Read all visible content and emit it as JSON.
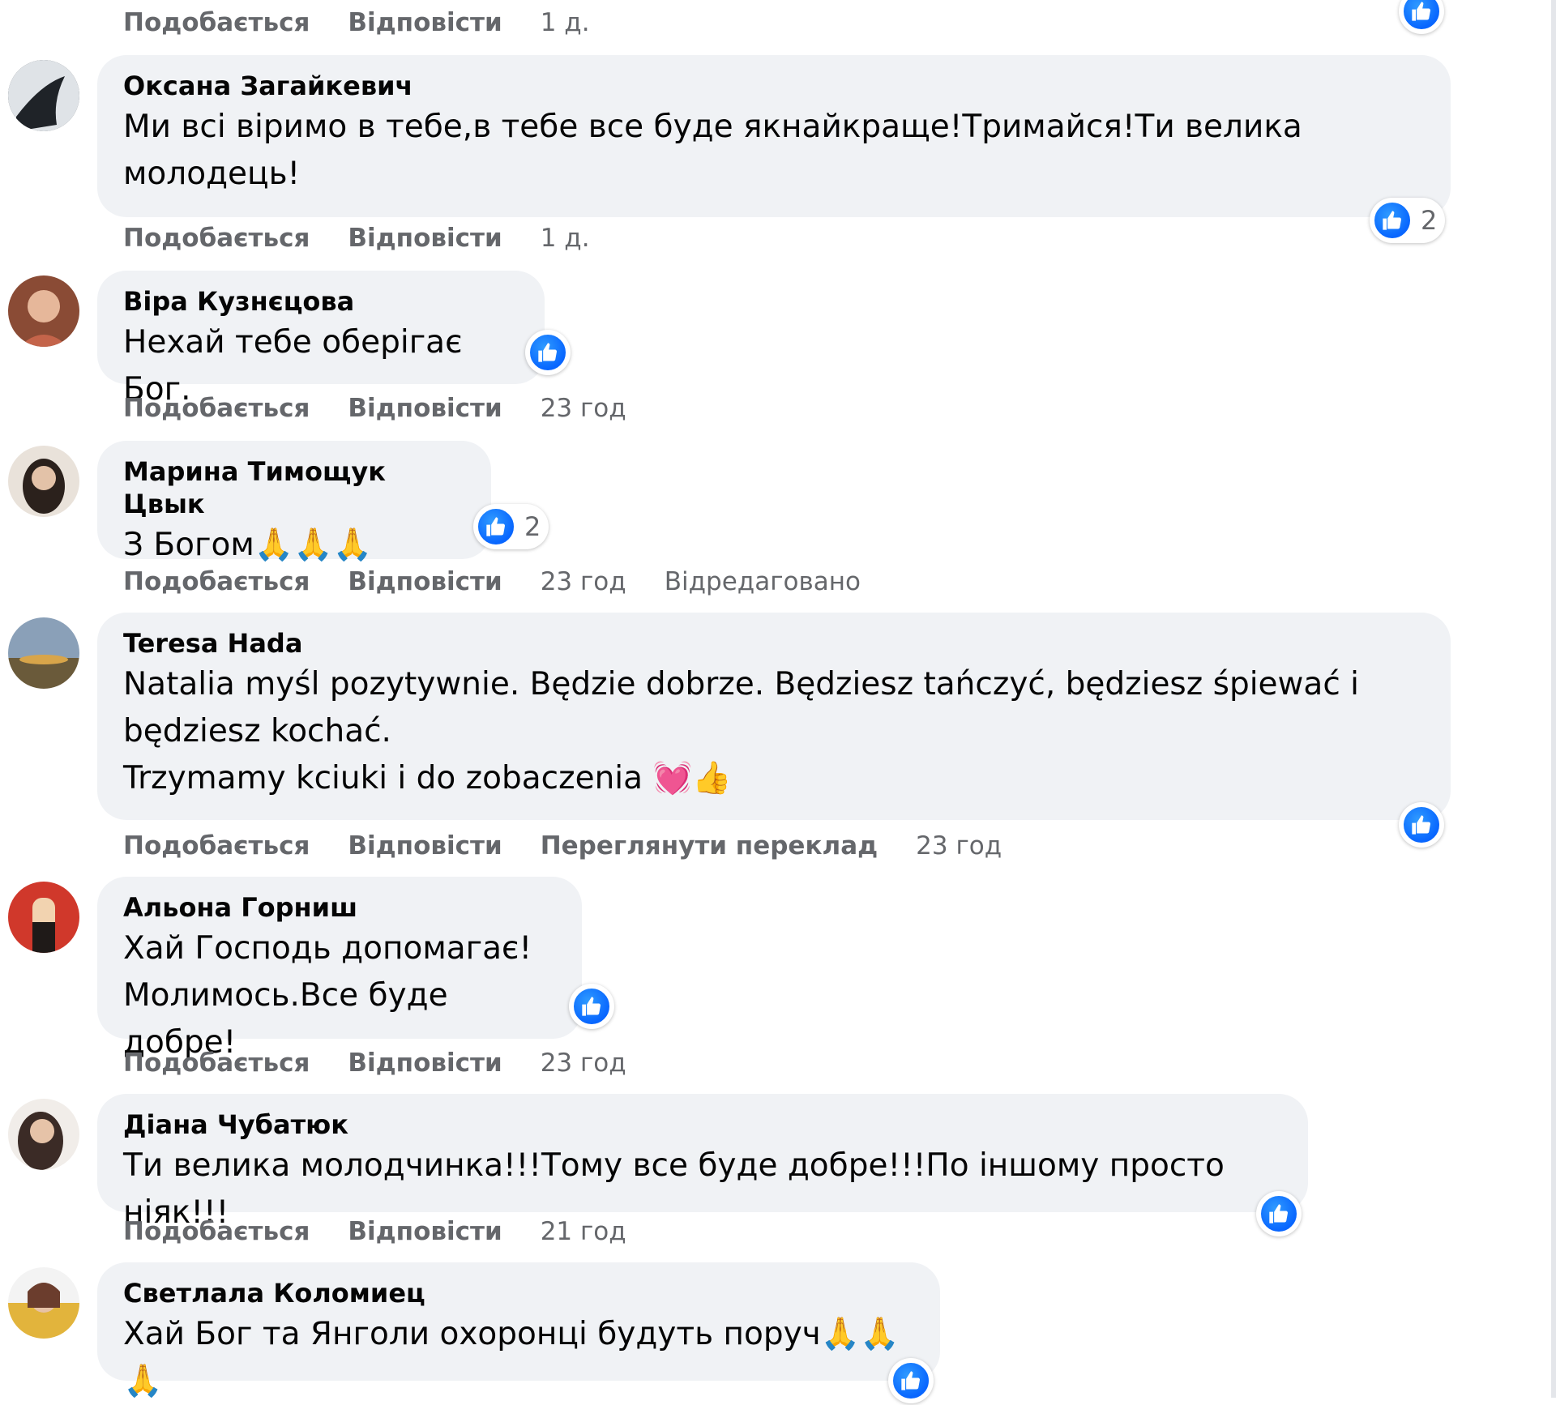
{
  "actions_labels": {
    "like": "Подобається",
    "reply": "Відповісти",
    "see_translation": "Переглянути переклад",
    "edited": "Відредаговано"
  },
  "top_row": {
    "time": "1 д."
  },
  "comments": [
    {
      "author": "Оксана Загайкевич",
      "lines": [
        "Ми всі віримо в тебе,в тебе все буде якнайкраще!Тримайся!Ти велика",
        "молодець!"
      ],
      "time": "1 д.",
      "reaction_count": "2",
      "avatar_color": "#3a3f44"
    },
    {
      "author": "Віра Кузнєцова",
      "lines": [
        "Нехай тебе оберігає Бог."
      ],
      "time": "23 год",
      "reaction_count": "",
      "avatar_color": "#c98a6a"
    },
    {
      "author": "Марина Тимощук Цвык",
      "lines": [
        "З Богом"
      ],
      "emoji": "🙏🙏🙏",
      "time": "23 год",
      "reaction_count": "2",
      "avatar_color": "#4b3d36"
    },
    {
      "author": "Teresa Hada",
      "lines": [
        "Natalia myśl pozytywnie. Będzie dobrze. Będziesz tańczyć, będziesz śpiewać i",
        "będziesz kochać.",
        "Trzymamy kciuki i do zobaczenia"
      ],
      "emoji": "💓👍",
      "time": "23 год",
      "reaction_count": "",
      "avatar_color": "#6d7a8a"
    },
    {
      "author": "Альона Горниш",
      "lines": [
        "Хай Господь допомагає!",
        "Молимось.Все буде добре!"
      ],
      "time": "23 год",
      "reaction_count": "",
      "avatar_color": "#d0382b"
    },
    {
      "author": "Діана Чубатюк",
      "lines": [
        "Ти велика молодчинка!!!Тому все буде добре!!!По іншому просто ніяк!!!"
      ],
      "time": "21 год",
      "reaction_count": "",
      "avatar_color": "#5a4a44"
    },
    {
      "author": "Светлала Коломиец",
      "lines": [
        "Хай Бог та Янголи охоронці будуть поруч"
      ],
      "emoji": "🙏🙏🙏",
      "time": "",
      "reaction_count": "",
      "avatar_color": "#e2b43c"
    }
  ],
  "colors": {
    "bubble_bg": "#f0f2f5",
    "meta_text": "#65676b",
    "like_blue": "#0866ff"
  },
  "icons": {
    "like": "like-thumbs-up-icon"
  }
}
